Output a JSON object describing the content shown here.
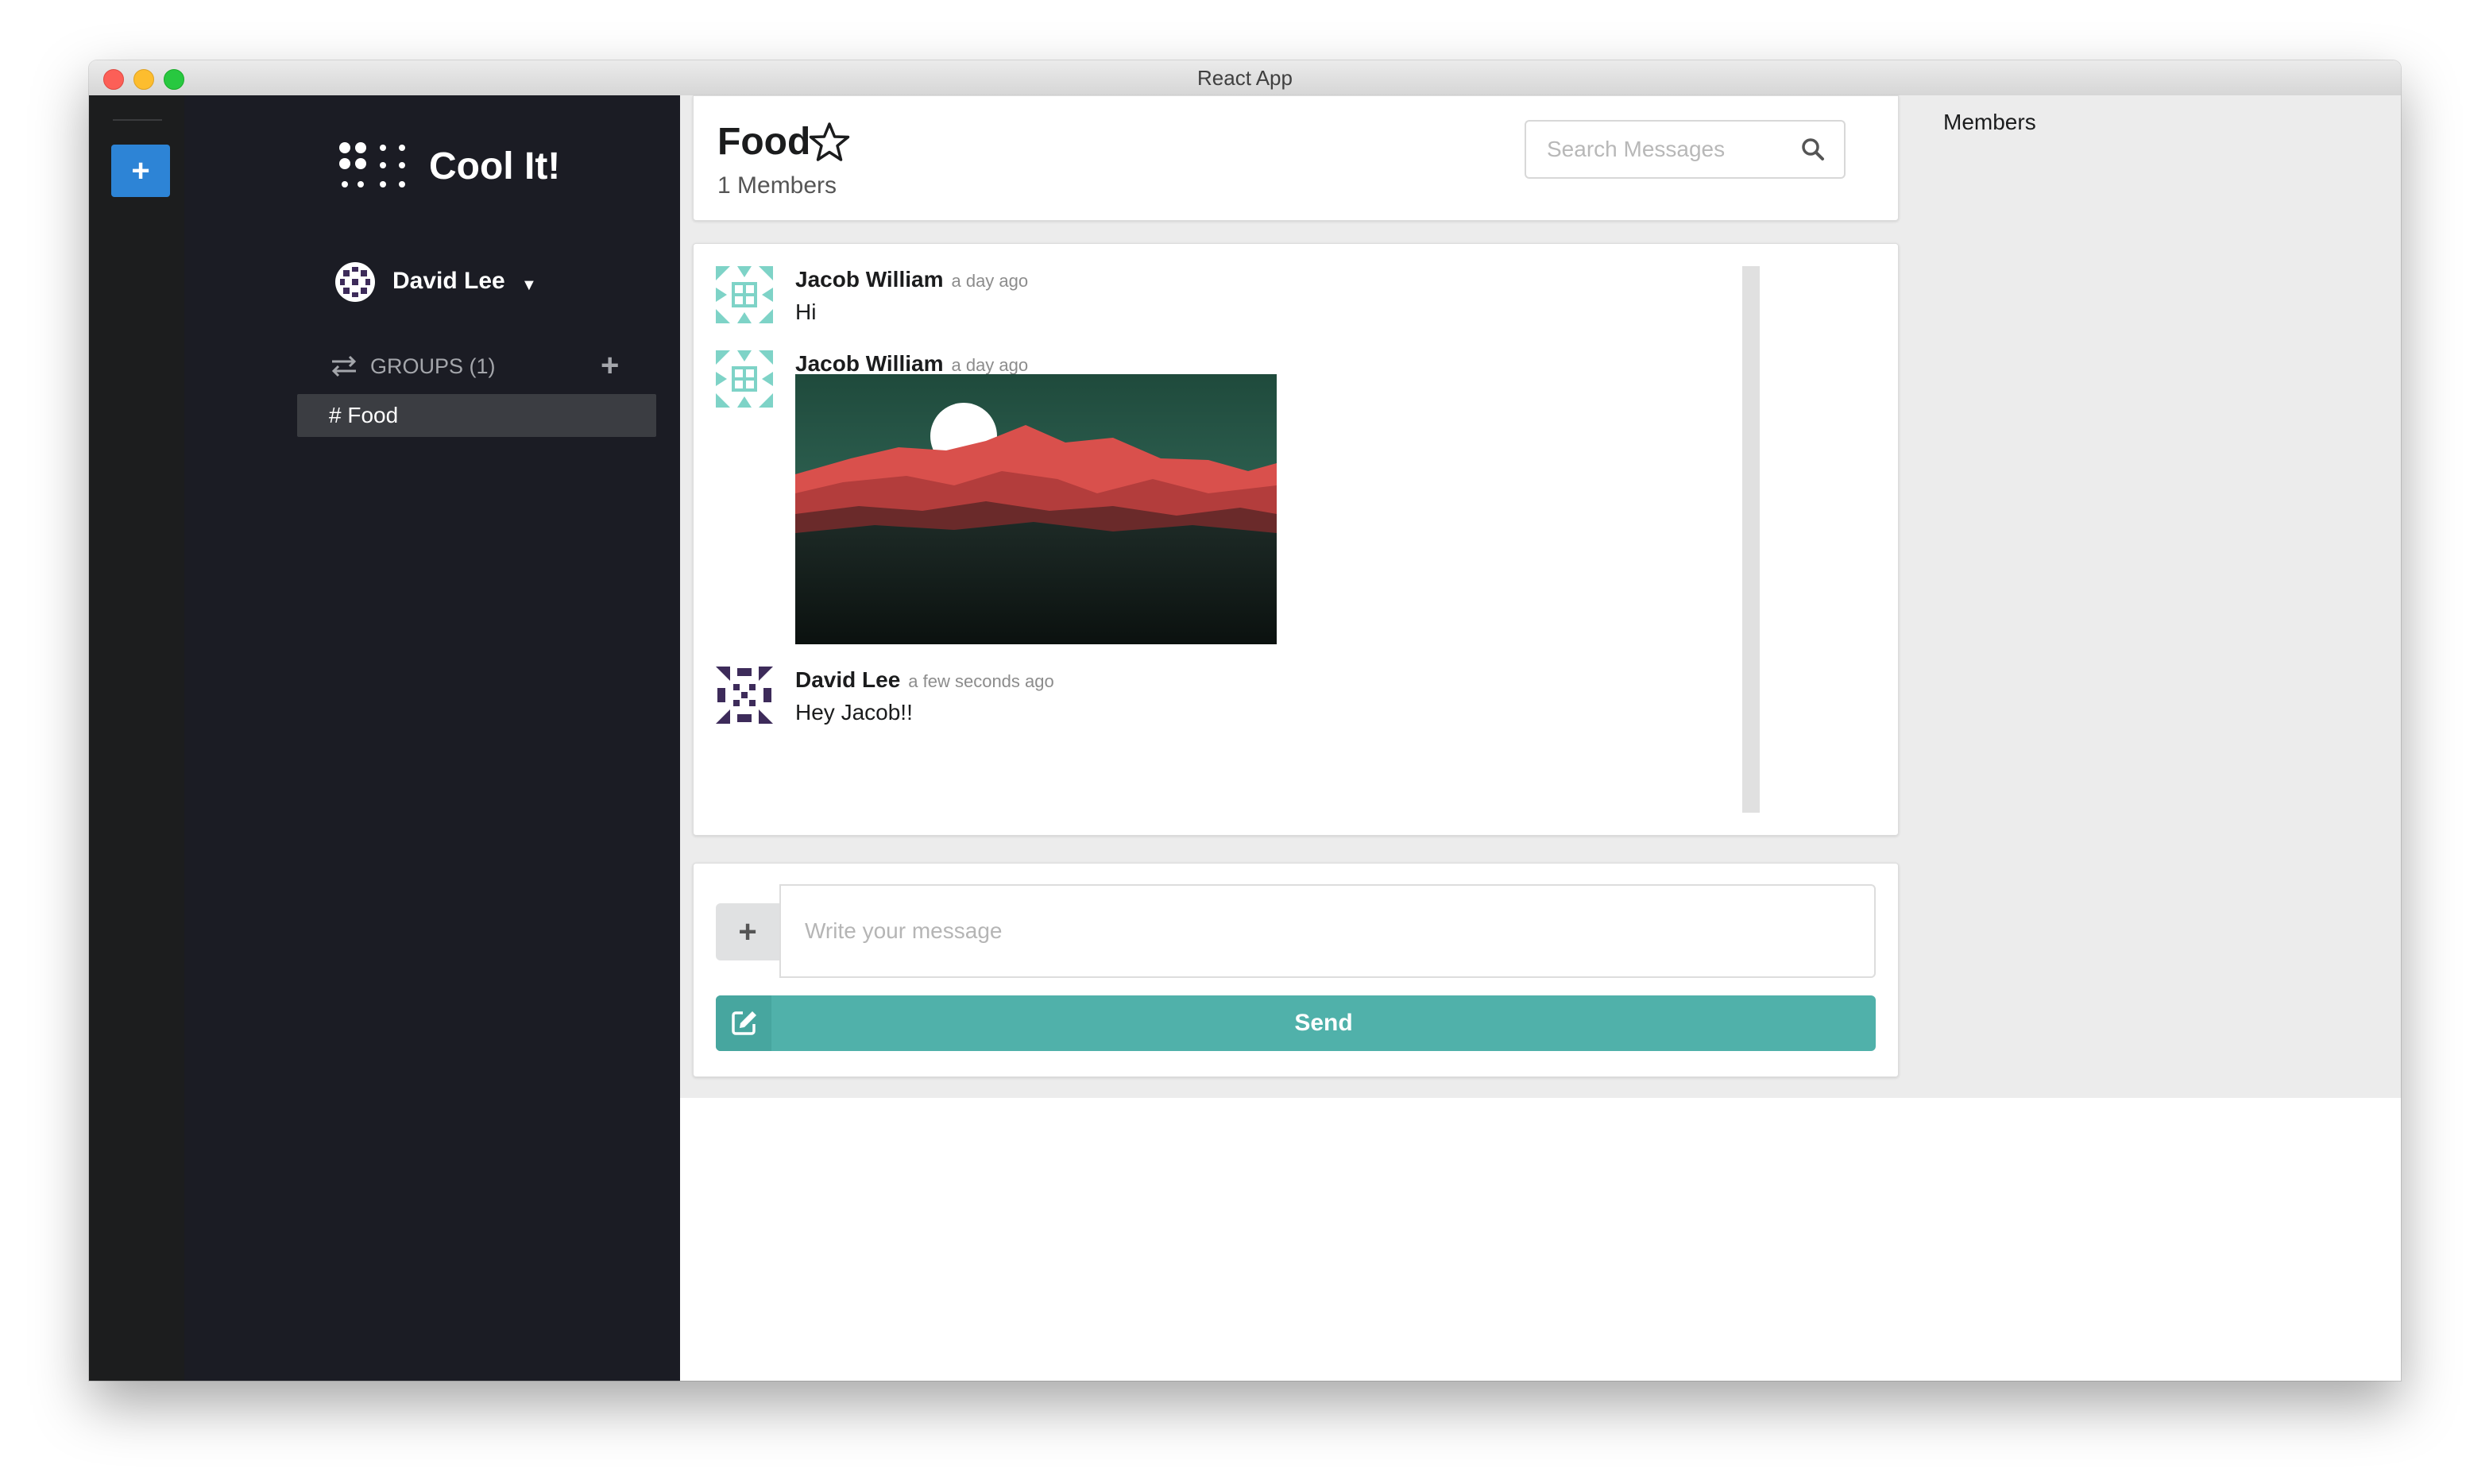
{
  "window": {
    "title": "React App"
  },
  "rail": {
    "add_label": "+"
  },
  "sidebar": {
    "app_name": "Cool It!",
    "user": {
      "name": "David Lee"
    },
    "groups": {
      "label": "GROUPS (1)",
      "add_label": "+"
    },
    "channels": [
      {
        "label": "# Food",
        "active": true
      }
    ]
  },
  "header": {
    "title": "Food",
    "members": "1 Members",
    "search": {
      "placeholder": "Search Messages"
    }
  },
  "messages": [
    {
      "author": "Jacob William",
      "time": "a day ago",
      "text": "Hi",
      "avatar": "identicon-teal"
    },
    {
      "author": "Jacob William",
      "time": "a day ago",
      "text": "",
      "avatar": "identicon-teal",
      "image": "mountain-sunset-image"
    },
    {
      "author": "David Lee",
      "time": "a few seconds ago",
      "text": "Hey Jacob!!",
      "avatar": "identicon-purple"
    }
  ],
  "composer": {
    "attach_label": "+",
    "placeholder": "Write your message",
    "send_label": "Send"
  },
  "members_panel": {
    "title": "Members"
  },
  "colors": {
    "accent": "#50b1aa",
    "rail_button": "#2d84d6",
    "sidebar_bg": "#1b1c24",
    "rail_bg": "#1c1d1e"
  }
}
